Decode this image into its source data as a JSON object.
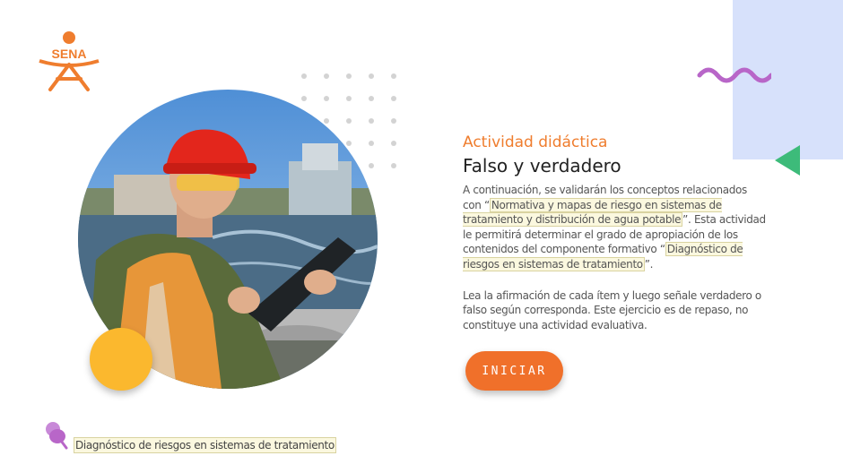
{
  "brand": {
    "logo_text": "SENA",
    "logo_color": "#ef7d2e"
  },
  "activity": {
    "subtitle": "Actividad didáctica",
    "title": "Falso y verdadero",
    "intro_1": "A continuación, se validarán los conceptos relacionados con “",
    "topic_1": "Normativa y mapas de riesgo en sistemas de tratamiento y distribución de agua potable",
    "intro_2": "”.  Esta actividad le permitirá determinar el grado de apropiación de los contenidos del componente formativo “",
    "topic_2": "Diagnóstico de riesgos en sistemas de tratamiento",
    "intro_3": "”.",
    "instructions": "Lea la afirmación de cada ítem y luego señale verdadero o falso según corresponda.  Este ejercicio es de repaso, no constituye una actividad evaluativa."
  },
  "start_button": {
    "label": "INICIAR",
    "color": "#f0702a"
  },
  "footer": {
    "label": "Diagnóstico de riesgos en sistemas de tratamiento"
  },
  "colors": {
    "accent_orange": "#ef7d2e",
    "panel_blue": "#d7e1fb",
    "wave_purple": "#b866c8",
    "triangle_green": "#3dbb7a",
    "circle_yellow": "#fbb82e"
  },
  "photo": {
    "alt": "worker-with-clipboard-at-water-treatment-plant"
  }
}
